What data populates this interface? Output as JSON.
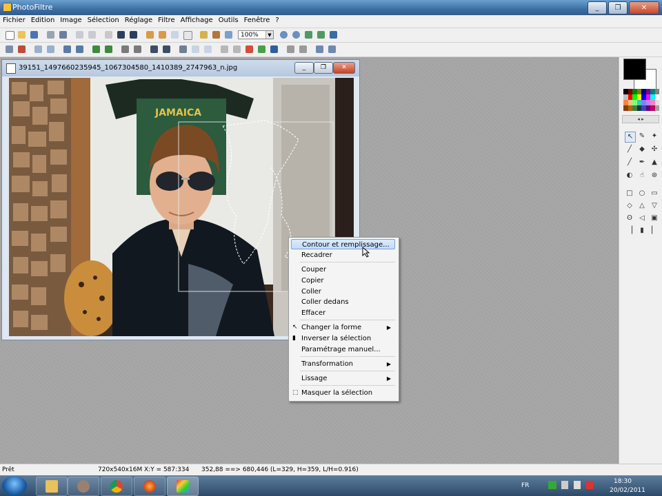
{
  "app": {
    "title": "PhotoFiltre",
    "window_buttons": [
      "_",
      "❐",
      "✕"
    ]
  },
  "menu": [
    "Fichier",
    "Edition",
    "Image",
    "Sélection",
    "Réglage",
    "Filtre",
    "Affichage",
    "Outils",
    "Fenêtre",
    "?"
  ],
  "toolbar": {
    "zoom": "100%"
  },
  "document": {
    "title": "39151_1497660235945_1067304580_1410389_2747963_n.jpg"
  },
  "photo": {
    "shirt_text": "JAMAICA"
  },
  "context_menu": {
    "items": [
      {
        "label": "Contour et remplissage...",
        "highlighted": true
      },
      {
        "label": "Recadrer"
      },
      {
        "label": "Couper"
      },
      {
        "label": "Copier"
      },
      {
        "label": "Coller"
      },
      {
        "label": "Coller dedans"
      },
      {
        "label": "Effacer"
      },
      {
        "label": "Changer la forme",
        "submenu": true
      },
      {
        "label": "Inverser la sélection"
      },
      {
        "label": "Paramétrage manuel..."
      },
      {
        "label": "Transformation",
        "submenu": true
      },
      {
        "label": "Lissage",
        "submenu": true
      },
      {
        "label": "Masquer la sélection"
      }
    ]
  },
  "colors": {
    "foreground": "#000000",
    "background": "#ffffff",
    "accent": "#3d6fa4"
  },
  "status": {
    "state": "Prêt",
    "image_info": "720x540x16M",
    "xy": "X:Y = 587:334",
    "selection": "352,88 ==> 680,446 (L=329, H=359, L/H=0.916)"
  },
  "tray": {
    "lang": "FR",
    "time": "18:30",
    "date": "20/02/2011"
  }
}
